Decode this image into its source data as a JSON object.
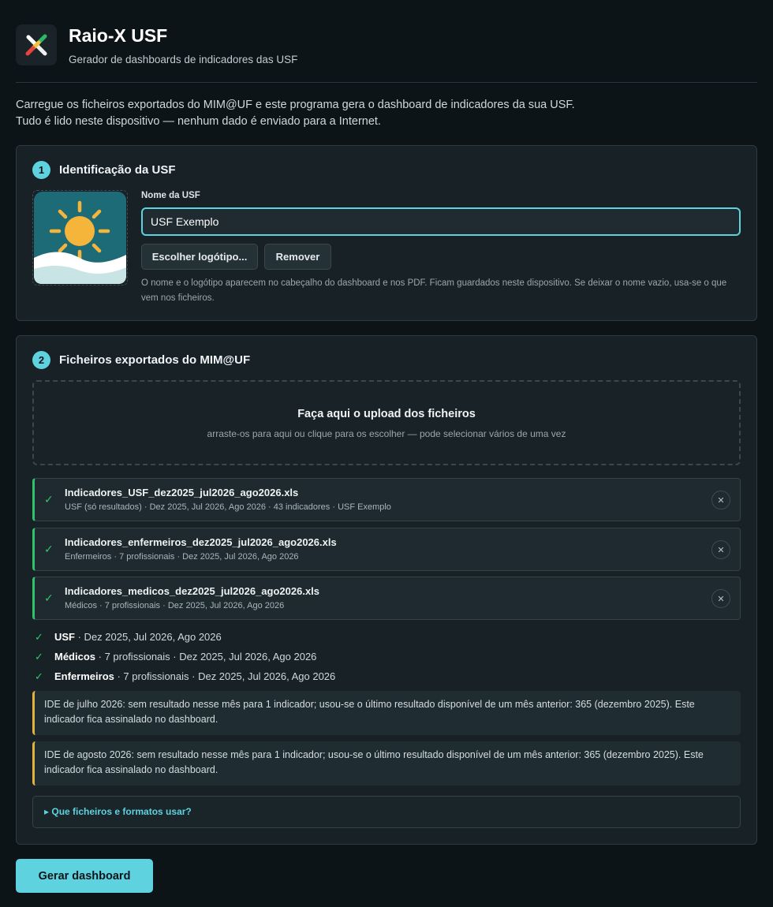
{
  "app": {
    "title": "Raio-X USF",
    "subtitle": "Gerador de dashboards de indicadores das USF",
    "logo_icon": "colored-x-icon"
  },
  "intro": {
    "line1": "Carregue os ficheiros exportados do MIM@UF e este programa gera o dashboard de indicadores da sua USF.",
    "line2": "Tudo é lido neste dispositivo — nenhum dado é enviado para a Internet."
  },
  "identification": {
    "step": "1",
    "title": "Identificação da USF",
    "name_label": "Nome da USF",
    "name_value": "USF Exemplo",
    "choose_logo_label": "Escolher logótipo...",
    "remove_label": "Remover",
    "help_text": "O nome e o logótipo aparecem no cabeçalho do dashboard e nos PDF. Ficam guardados neste dispositivo. Se deixar o nome vazio, usa-se o que vem nos ficheiros.",
    "logo_icon": "sun-waves-icon"
  },
  "files": {
    "step": "2",
    "title": "Ficheiros exportados do MIM@UF",
    "dropzone_title": "Faça aqui o upload dos ficheiros",
    "dropzone_sub": "arraste-os para aqui ou clique para os escolher — pode selecionar vários de uma vez",
    "items": [
      {
        "check": "✓",
        "name": "Indicadores_USF_dez2025_jul2026_ago2026.xls",
        "meta": "USF (só resultados) · Dez 2025, Jul 2026, Ago 2026 · 43 indicadores · USF Exemplo",
        "remove": "✕"
      },
      {
        "check": "✓",
        "name": "Indicadores_enfermeiros_dez2025_jul2026_ago2026.xls",
        "meta": "Enfermeiros · 7 profissionais · Dez 2025, Jul 2026, Ago 2026",
        "remove": "✕"
      },
      {
        "check": "✓",
        "name": "Indicadores_medicos_dez2025_jul2026_ago2026.xls",
        "meta": "Médicos · 7 profissionais · Dez 2025, Jul 2026, Ago 2026",
        "remove": "✕"
      }
    ],
    "summary": [
      {
        "check": "✓",
        "label": "USF",
        "detail": " · Dez 2025, Jul 2026, Ago 2026"
      },
      {
        "check": "✓",
        "label": "Médicos",
        "detail": " · 7 profissionais · Dez 2025, Jul 2026, Ago 2026"
      },
      {
        "check": "✓",
        "label": "Enfermeiros",
        "detail": " · 7 profissionais · Dez 2025, Jul 2026, Ago 2026"
      }
    ],
    "warnings": [
      "IDE de julho 2026: sem resultado nesse mês para 1 indicador; usou-se o último resultado disponível de um mês anterior: 365 (dezembro 2025). Este indicador fica assinalado no dashboard.",
      "IDE de agosto 2026: sem resultado nesse mês para 1 indicador; usou-se o último resultado disponível de um mês anterior: 365 (dezembro 2025). Este indicador fica assinalado no dashboard."
    ],
    "faq_label": "▸ Que ficheiros e formatos usar?"
  },
  "generate_label": "Gerar dashboard",
  "colors": {
    "accent": "#5fd2df",
    "success": "#31c26a",
    "warning": "#e0b341",
    "background": "#0d1417",
    "card": "#172126"
  }
}
